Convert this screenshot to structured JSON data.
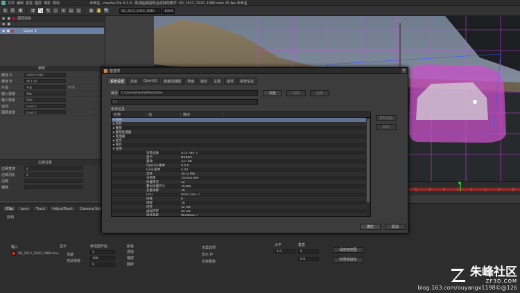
{
  "window": {
    "title": "未命名 - mocha Pro 4.1.0 - 影视后期视效合成特效教学",
    "title_right": "SD_2012_1920_1080.mov 25 fps 未命名"
  },
  "menu": [
    "文件",
    "编辑",
    "查看",
    "图层",
    "电影",
    "帮助"
  ],
  "toolbar": {
    "tools": [
      "↖",
      "⇱",
      "✥",
      "↺",
      "⤡",
      "✎",
      "◌",
      "⌖",
      "▭",
      "◇",
      "⊕",
      "✋",
      "🔍"
    ],
    "selected_index": 4,
    "clip_label": "SD_2012_1920_1080",
    "zoom": "100%"
  },
  "layers": {
    "header": "图层控制",
    "items": [
      {
        "name": "Layer 1",
        "selected": true
      }
    ]
  },
  "left_params": {
    "header": "参数",
    "rows": [
      {
        "label": "缓存 G",
        "value": "分配中 0.000",
        "extra": ""
      },
      {
        "label": "缓存 B",
        "value": "AP 1.00",
        "extra": ""
      },
      {
        "label": "片段",
        "value": "平滑",
        "extra": "平滑"
      },
      {
        "label": "输入通道",
        "value": "亮度",
        "extra": ""
      },
      {
        "label": "最少像素",
        "value": "50%",
        "extra": ""
      },
      {
        "label": "运动",
        "value": "Layer 1",
        "extra": ""
      },
      {
        "label": "图层遮罩",
        "value": "Layer 1",
        "extra": ""
      }
    ],
    "section2": "边缘设置",
    "edge_rows": [
      {
        "label": "边缘宽度",
        "value": "4"
      },
      {
        "label": "边缘羽化",
        "value": "2"
      },
      {
        "label": "边缘",
        "value": ""
      },
      {
        "label": "偏移",
        "value": ""
      }
    ]
  },
  "viewer": {
    "timeline_marker": "▼"
  },
  "bottom": {
    "tabs": [
      {
        "label": "Clip",
        "active": true
      },
      {
        "label": "Lens"
      },
      {
        "label": "Track"
      },
      {
        "label": "AdjustTrack"
      },
      {
        "label": "Camera Solve"
      }
    ],
    "clip_header": "剪辑",
    "input_label": "输入",
    "clip_name": "SD_2012_1920_1080.mov",
    "display_label": "显示",
    "display_options": [
      "清楚",
      "自动通道"
    ],
    "range_label": "帧范围开始",
    "range_values": [
      "1",
      "100",
      "0"
    ],
    "col3": [
      "颜色",
      "通道",
      "缩放",
      "翻转"
    ],
    "col4": [
      "无需选项",
      "显示 IP",
      "反转图像"
    ],
    "col5_label": "水平",
    "col5_label2": "垂直",
    "col5_values": [
      "1.0",
      "0",
      "0.0"
    ],
    "buttons": [
      "设定帧范围",
      "时间线设定"
    ]
  },
  "dialog": {
    "title": "首选项",
    "close": "×",
    "tabs": [
      {
        "label": "系统设置",
        "active": true
      },
      {
        "label": "高级"
      },
      {
        "label": "OpenGL"
      },
      {
        "label": "键盘快捷键"
      },
      {
        "label": "界面"
      },
      {
        "label": "输出"
      },
      {
        "label": "主题"
      },
      {
        "label": "插件"
      },
      {
        "label": "系统信息"
      }
    ],
    "cache_label": "缓存",
    "cache_path": "C:\\Users\\mocha\\Pro\\cache",
    "browse_btn": "浏览",
    "clear_btn": "清除",
    "apply_btn": "应用",
    "path_field": "C:\\",
    "tree_label": "系统信息",
    "tree_columns": [
      "名称",
      "值",
      "描述"
    ],
    "tree_rows": [
      {
        "c1": "▾ 系统",
        "c2": "",
        "c3": "",
        "sel": true
      },
      {
        "c1": "  ▸ 内存",
        "c2": "",
        "c3": ""
      },
      {
        "c1": "  ▸ 硬盘",
        "c2": "",
        "c3": ""
      },
      {
        "c1": "  ▸ 图形处理器",
        "c2": "",
        "c3": ""
      },
      {
        "c1": "  ▸ 处理器",
        "c2": "",
        "c3": ""
      },
      {
        "c1": "  ▸ 显示",
        "c2": "",
        "c3": ""
      },
      {
        "c1": "  ▸ 操作",
        "c2": "",
        "c3": ""
      },
      {
        "c1": "▾ 应用",
        "c2": "",
        "c3": ""
      },
      {
        "c1": "",
        "c2": "渲染设备",
        "c3": "GTX 780 Ti"
      },
      {
        "c1": "",
        "c2": "显卡",
        "c3": "NVIDIA"
      },
      {
        "c1": "",
        "c2": "驱动",
        "c3": "337.88"
      },
      {
        "c1": "",
        "c2": "OpenGL版本",
        "c3": "4.4.0"
      },
      {
        "c1": "",
        "c2": "GLSL版本",
        "c3": "4.40"
      },
      {
        "c1": "",
        "c2": "显存",
        "c3": "3072 MB"
      },
      {
        "c1": "",
        "c2": "分辨率",
        "c3": "1920x1080"
      },
      {
        "c1": "",
        "c2": "纹理单元",
        "c3": "32"
      },
      {
        "c1": "",
        "c2": "最大纹理尺寸",
        "c3": "16384"
      },
      {
        "c1": "",
        "c2": "多重采样",
        "c3": "16"
      },
      {
        "c1": "",
        "c2": "CPU",
        "c3": "Intel Core i7"
      },
      {
        "c1": "",
        "c2": "内核",
        "c3": "8"
      },
      {
        "c1": "",
        "c2": "线程",
        "c3": "16"
      },
      {
        "c1": "",
        "c2": "内存",
        "c3": "32 GB"
      },
      {
        "c1": "",
        "c2": "虚拟内存",
        "c3": "64 GB"
      },
      {
        "c1": "",
        "c2": "操作系统",
        "c3": "Windows 7"
      },
      {
        "c1": "",
        "c2": "系统类型",
        "c3": "64位"
      }
    ],
    "side_btn1": "复制信息",
    "side_btn2": "刷新",
    "ok": "确定",
    "cancel": "取消"
  },
  "watermark": {
    "brand": "朱峰社区",
    "domain": "ZF3D.COM",
    "blog": "blog.163.com/ouyangx1198©@126"
  },
  "colors": {
    "mask": "#c850c8",
    "grid": "#e040ff",
    "selection": "#6b7fa6"
  }
}
